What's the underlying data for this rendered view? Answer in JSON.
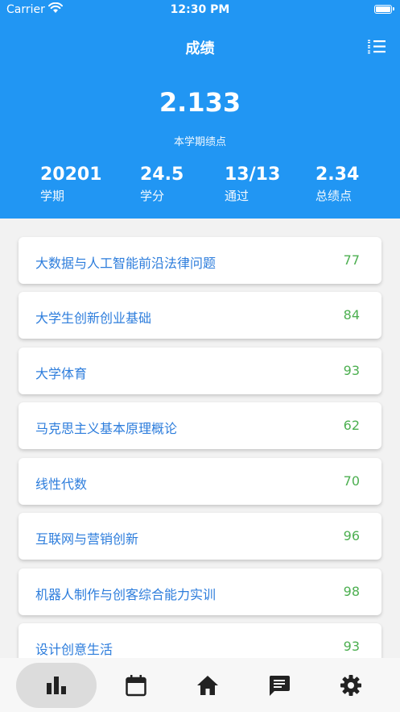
{
  "status": {
    "carrier": "Carrier",
    "time": "12:30 PM"
  },
  "header": {
    "title": "成绩",
    "menu_icon": "list-icon"
  },
  "summary": {
    "gpa": "2.133",
    "gpa_label": "本学期绩点",
    "stats": [
      {
        "value": "20201",
        "label": "学期"
      },
      {
        "value": "24.5",
        "label": "学分"
      },
      {
        "value": "13/13",
        "label": "通过"
      },
      {
        "value": "2.34",
        "label": "总绩点"
      }
    ]
  },
  "courses": [
    {
      "name": "大数据与人工智能前沿法律问题",
      "score": "77"
    },
    {
      "name": "大学生创新创业基础",
      "score": "84"
    },
    {
      "name": "大学体育",
      "score": "93"
    },
    {
      "name": "马克思主义基本原理概论",
      "score": "62"
    },
    {
      "name": "线性代数",
      "score": "70"
    },
    {
      "name": "互联网与营销创新",
      "score": "96"
    },
    {
      "name": "机器人制作与创客综合能力实训",
      "score": "98"
    },
    {
      "name": "设计创意生活",
      "score": "93"
    }
  ],
  "nav": [
    {
      "icon": "bar-chart-icon",
      "active": true
    },
    {
      "icon": "calendar-icon",
      "active": false
    },
    {
      "icon": "home-icon",
      "active": false
    },
    {
      "icon": "message-icon",
      "active": false
    },
    {
      "icon": "gear-icon",
      "active": false
    }
  ],
  "colors": {
    "primary": "#2196f3",
    "course_name": "#2d7ddc",
    "score": "#4caf50"
  }
}
